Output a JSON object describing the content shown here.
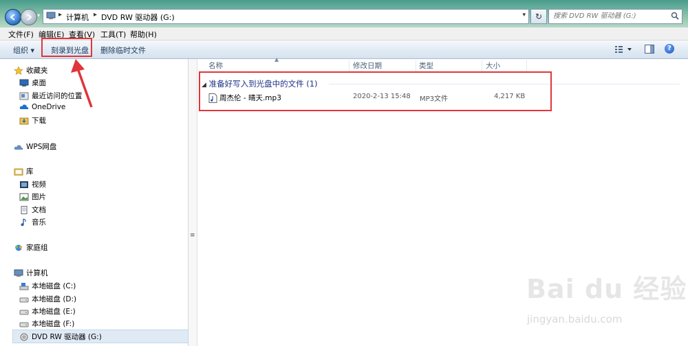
{
  "address": {
    "crumbs": [
      "计算机",
      "DVD RW 驱动器 (G:)"
    ]
  },
  "search": {
    "placeholder": "搜索 DVD RW 驱动器 (G:)"
  },
  "menu": [
    "文件(F)",
    "编辑(E)",
    "查看(V)",
    "工具(T)",
    "帮助(H)"
  ],
  "toolbar": {
    "organize": "组织 ▾",
    "burn": "刻录到光盘",
    "delete_temp": "删除临时文件"
  },
  "sidebar": {
    "favorites": "收藏夹",
    "desktop": "桌面",
    "recent": "最近访问的位置",
    "onedrive": "OneDrive",
    "downloads": "下载",
    "wps": "WPS网盘",
    "libraries": "库",
    "videos": "视频",
    "pictures": "图片",
    "documents": "文档",
    "music": "音乐",
    "homegroup": "家庭组",
    "computer": "计算机",
    "drive_c": "本地磁盘 (C:)",
    "drive_d": "本地磁盘 (D:)",
    "drive_e": "本地磁盘 (E:)",
    "drive_f": "本地磁盘 (F:)",
    "drive_g": "DVD RW 驱动器 (G:)"
  },
  "columns": {
    "name": "名称",
    "date": "修改日期",
    "type": "类型",
    "size": "大小"
  },
  "group": {
    "label": "准备好写入到光盘中的文件 (1)"
  },
  "files": [
    {
      "name": "周杰伦 - 晴天.mp3",
      "date": "2020-2-13 15:48",
      "type": "MP3文件",
      "size": "4,217 KB"
    }
  ],
  "watermark": {
    "brand": "Bai du 经验",
    "url": "jingyan.baidu.com"
  },
  "colors": {
    "highlight_box": "#e0353a",
    "toolbar_text": "#1e395b",
    "group_text": "#1e3287"
  }
}
